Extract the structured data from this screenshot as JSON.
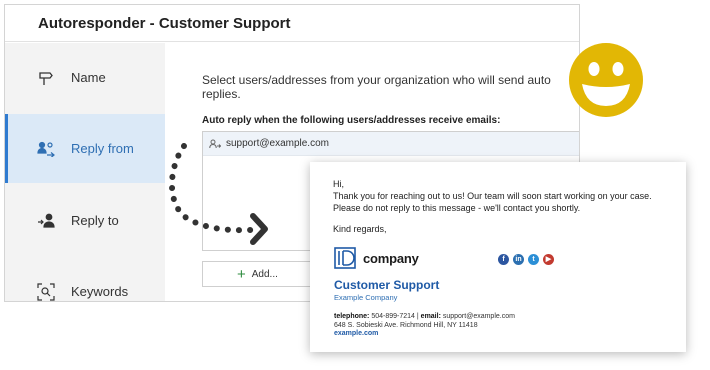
{
  "window": {
    "title": "Autoresponder - Customer Support"
  },
  "sidebar": {
    "items": [
      {
        "label": "Name",
        "icon": "signpost-icon",
        "active": false
      },
      {
        "label": "Reply from",
        "icon": "user-reply-icon",
        "active": true
      },
      {
        "label": "Reply to",
        "icon": "user-arrow-icon",
        "active": false
      },
      {
        "label": "Keywords",
        "icon": "keyword-search-icon",
        "active": false
      }
    ]
  },
  "main": {
    "intro": "Select users/addresses from your organization who will send auto replies.",
    "section_label": "Auto reply when the following users/addresses receive emails:",
    "addresses": [
      "support@example.com"
    ],
    "add_label": "Add..."
  },
  "email": {
    "greeting": "Hi,",
    "line1": "Thank you for reaching out to us! Our team will soon start working on your case.",
    "line2": "Please do not reply to this message - we'll contact you shortly.",
    "regards": "Kind regards,",
    "logo_text": "company",
    "social": [
      "facebook-icon",
      "linkedin-icon",
      "twitter-icon",
      "youtube-icon"
    ],
    "signature_name": "Customer Support",
    "signature_company": "Example Company",
    "telephone_label": "telephone:",
    "telephone": "504-899-7214",
    "separator": "|",
    "email_label": "email:",
    "email_address": "support@example.com",
    "address": "648 S. Sobieski Ave. Richmond Hill, NY 11418",
    "website": "example.com"
  },
  "colors": {
    "accent": "#2f7bd0",
    "active_bg": "#dbe9f7",
    "sidebar_bg": "#f3f3f3",
    "smiley": "#e2b705",
    "signature": "#1f5aa6"
  }
}
